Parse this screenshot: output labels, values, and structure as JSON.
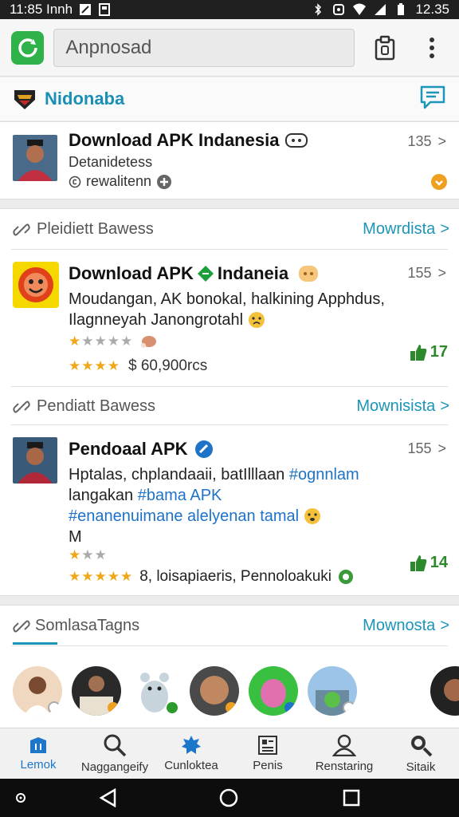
{
  "status_bar": {
    "time_left": "11:85 Innh",
    "time_right": "12.35"
  },
  "toolbar": {
    "search_value": "Anpnosad"
  },
  "brand": {
    "name": "Nidonaba"
  },
  "card1": {
    "title": "Download APK Indanesia",
    "subtitle": "Detanidetess",
    "meta": "rewalitenn",
    "count": "135"
  },
  "section1": {
    "heading": "Pleidiett Bawess",
    "more": "Mowrdista",
    "item": {
      "title_a": "Download APK",
      "title_b": "Indaneia",
      "count": "155",
      "desc_line1": "Moudangan, AK bonokal, halkining Apphdus,",
      "desc_line2": "Ilagnneyah Janongrotahl",
      "price": "$ 60,900rcs",
      "likes": "17"
    }
  },
  "section2": {
    "heading": "Pendiatt Bawess",
    "more": "Mownisista",
    "item": {
      "title": "Pendoaal APK",
      "count": "155",
      "desc_line1_a": "Hptalas, chplandaaii, batIlllaan ",
      "desc_line1_tag": "#ognnlam",
      "desc_line2_a": "langakan ",
      "desc_line2_tag": "#bama APK",
      "desc_line3_tag": "#enanenuimane alelyenan tamal",
      "desc_line4": "M",
      "reviews": "8, loisapiaeris, Pennoloakuki",
      "likes": "14"
    }
  },
  "section3": {
    "heading": "SomlasaTagns",
    "more": "Mownosta"
  },
  "bottom_nav": [
    {
      "label": "Lemok",
      "icon": "home-icon"
    },
    {
      "label": "Naggangeify",
      "icon": "search-icon"
    },
    {
      "label": "Cunloktea",
      "icon": "apps-icon"
    },
    {
      "label": "Penis",
      "icon": "news-icon"
    },
    {
      "label": "Renstaring",
      "icon": "profile-icon"
    },
    {
      "label": "Sitaik",
      "icon": "search-icon"
    }
  ],
  "colors": {
    "accent": "#1c76c9",
    "brand": "#1b95b8",
    "green": "#2fb24a"
  }
}
